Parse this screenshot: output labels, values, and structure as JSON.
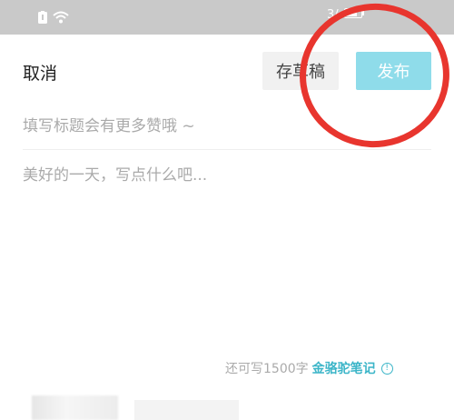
{
  "status_bar": {
    "left_icons": [
      "battery-icon",
      "wifi-icon"
    ],
    "right_text": "3/"
  },
  "header": {
    "cancel_label": "取消",
    "draft_label": "存草稿",
    "publish_label": "发布"
  },
  "editor": {
    "title_placeholder": "填写标题会有更多赞哦 ~",
    "content_placeholder": "美好的一天，写点什么吧..."
  },
  "footer": {
    "remaining_text": "还可写1500字",
    "guide_link": "金骆驼笔记",
    "info_icon_glyph": "!"
  },
  "colors": {
    "accent": "#8fdcea",
    "link": "#3bb5c8",
    "annotation": "#e8352e",
    "status_bar": "#c9c9c9"
  }
}
